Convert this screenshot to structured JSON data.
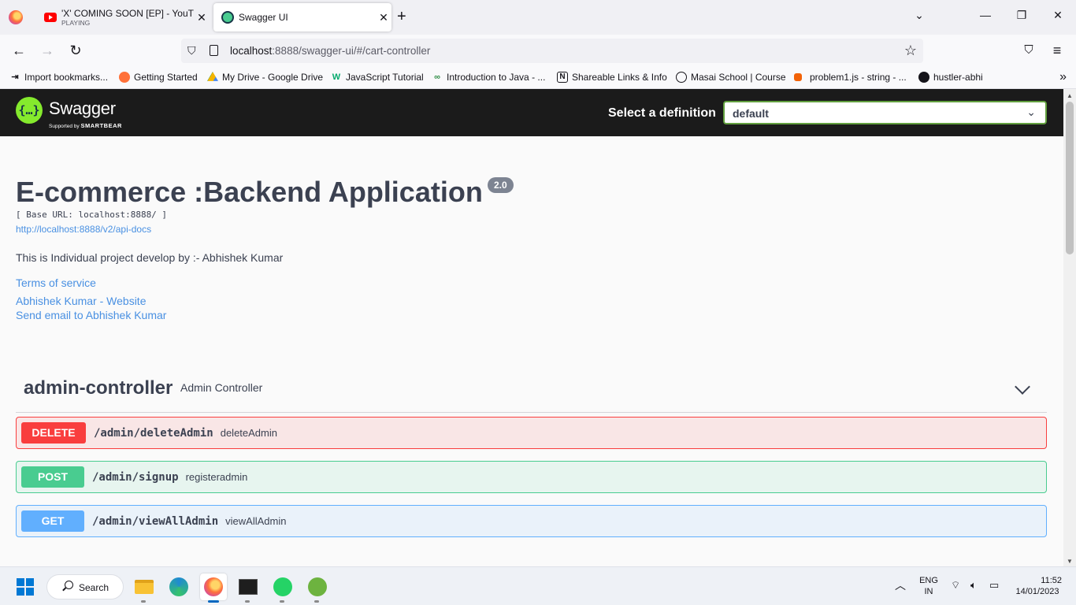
{
  "browser": {
    "tabs": [
      {
        "title": "'X' COMING SOON [EP] - YouTube",
        "subtitle": "PLAYING"
      },
      {
        "title": "Swagger UI"
      }
    ],
    "url_host": "localhost",
    "url_rest": ":8888/swagger-ui/#/cart-controller",
    "bookmarks": [
      "Import bookmarks...",
      "Getting Started",
      "My Drive - Google Drive",
      "JavaScript Tutorial",
      "Introduction to Java - ...",
      "Shareable Links & Info",
      "Masai School | Course",
      "problem1.js - string - ...",
      "hustler-abhi"
    ]
  },
  "swagger": {
    "logo_text": "Swagger",
    "logo_sub_prefix": "Supported by",
    "logo_sub_brand": "SMARTBEAR",
    "select_label": "Select a definition",
    "select_value": "default",
    "title": "E-commerce :Backend Application",
    "version": "2.0",
    "base_url": "[ Base URL: localhost:8888/ ]",
    "api_docs_link": "http://localhost:8888/v2/api-docs",
    "description": "This is Individual project develop by :- Abhishek Kumar",
    "terms": "Terms of service",
    "website": "Abhishek Kumar - Website",
    "email": "Send email to Abhishek Kumar",
    "tag": {
      "name": "admin-controller",
      "description": "Admin Controller"
    },
    "operations": [
      {
        "method": "DELETE",
        "path": "/admin/deleteAdmin",
        "summary": "deleteAdmin",
        "color": "#f93e3e"
      },
      {
        "method": "POST",
        "path": "/admin/signup",
        "summary": "registeradmin",
        "color": "#49cc90"
      },
      {
        "method": "GET",
        "path": "/admin/viewAllAdmin",
        "summary": "viewAllAdmin",
        "color": "#61affe"
      }
    ]
  },
  "taskbar": {
    "search_label": "Search",
    "lang_top": "ENG",
    "lang_bottom": "IN",
    "time": "11:52",
    "date": "14/01/2023"
  }
}
